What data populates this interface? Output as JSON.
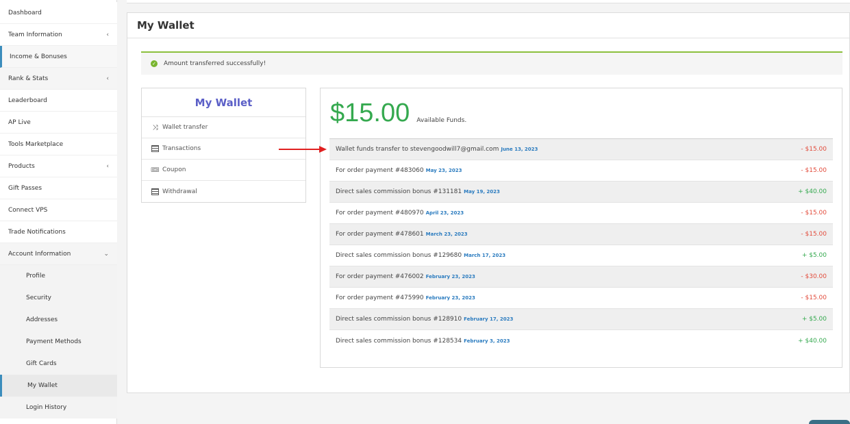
{
  "sidebar": {
    "items": [
      {
        "label": "Dashboard"
      },
      {
        "label": "Team Information",
        "chevron": "‹"
      },
      {
        "label": "Income & Bonuses"
      },
      {
        "label": "Rank & Stats",
        "chevron": "‹"
      },
      {
        "label": "Leaderboard"
      },
      {
        "label": "AP Live"
      },
      {
        "label": "Tools Marketplace"
      },
      {
        "label": "Products",
        "chevron": "‹"
      },
      {
        "label": "Gift Passes"
      },
      {
        "label": "Connect VPS"
      },
      {
        "label": "Trade Notifications"
      },
      {
        "label": "Account Information",
        "chevron": "⌄"
      }
    ],
    "sub_items": [
      {
        "label": "Profile"
      },
      {
        "label": "Security"
      },
      {
        "label": "Addresses"
      },
      {
        "label": "Payment Methods"
      },
      {
        "label": "Gift Cards"
      },
      {
        "label": "My Wallet"
      },
      {
        "label": "Login History"
      }
    ]
  },
  "page": {
    "title": "My Wallet"
  },
  "alert": {
    "message": "Amount transferred successfully!",
    "icon": "check-circle-icon",
    "color": "#79b530"
  },
  "wallet_menu": {
    "title": "My Wallet",
    "items": [
      {
        "label": "Wallet transfer",
        "icon": "shuffle-icon"
      },
      {
        "label": "Transactions",
        "icon": "list-icon"
      },
      {
        "label": "Coupon",
        "icon": "tickets-icon"
      },
      {
        "label": "Withdrawal",
        "icon": "list-icon"
      }
    ]
  },
  "funds": {
    "amount": "$15.00",
    "label": "Available Funds.",
    "amount_color": "#35a94f"
  },
  "transactions": [
    {
      "desc": "Wallet funds transfer to stevengoodwill7@gmail.com",
      "date": "June 13, 2023",
      "amount": "- $15.00",
      "sign": "neg"
    },
    {
      "desc": "For order payment #483060",
      "date": "May 23, 2023",
      "amount": "- $15.00",
      "sign": "neg"
    },
    {
      "desc": "Direct sales commission bonus #131181",
      "date": "May 19, 2023",
      "amount": "+ $40.00",
      "sign": "pos"
    },
    {
      "desc": "For order payment #480970",
      "date": "April 23, 2023",
      "amount": "- $15.00",
      "sign": "neg"
    },
    {
      "desc": "For order payment #478601",
      "date": "March 23, 2023",
      "amount": "- $15.00",
      "sign": "neg"
    },
    {
      "desc": "Direct sales commission bonus #129680",
      "date": "March 17, 2023",
      "amount": "+ $5.00",
      "sign": "pos"
    },
    {
      "desc": "For order payment #476002",
      "date": "February 23, 2023",
      "amount": "- $30.00",
      "sign": "neg"
    },
    {
      "desc": "For order payment #475990",
      "date": "February 23, 2023",
      "amount": "- $15.00",
      "sign": "neg"
    },
    {
      "desc": "Direct sales commission bonus #128910",
      "date": "February 17, 2023",
      "amount": "+ $5.00",
      "sign": "pos"
    },
    {
      "desc": "Direct sales commission bonus #128534",
      "date": "February 3, 2023",
      "amount": "+ $40.00",
      "sign": "pos"
    }
  ],
  "colors": {
    "accent": "#3c8dbc",
    "negative": "#e24b3b",
    "positive": "#35a94f",
    "menu_title": "#5b5fc7",
    "annotation_arrow": "#e02020"
  }
}
